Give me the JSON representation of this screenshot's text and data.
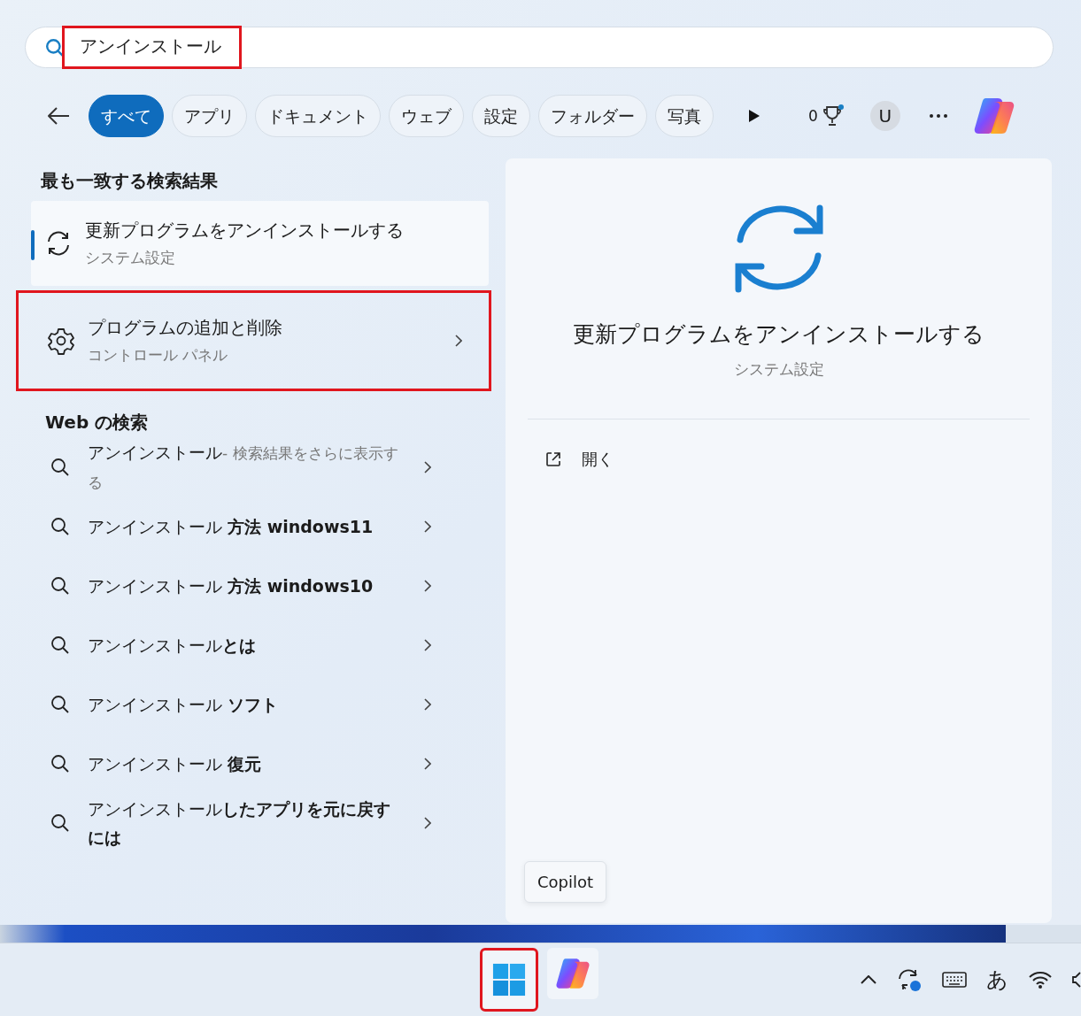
{
  "search": {
    "value": "アンインストール",
    "highlighted": true
  },
  "filters": [
    {
      "label": "すべて",
      "selected": true
    },
    {
      "label": "アプリ",
      "selected": false
    },
    {
      "label": "ドキュメント",
      "selected": false
    },
    {
      "label": "ウェブ",
      "selected": false
    },
    {
      "label": "設定",
      "selected": false
    },
    {
      "label": "フォルダー",
      "selected": false
    },
    {
      "label": "写真",
      "selected": false
    }
  ],
  "toolbar": {
    "points": "0",
    "avatar": "U"
  },
  "best_match": {
    "heading": "最も一致する検索結果",
    "items": [
      {
        "kind": "sync",
        "title": "更新プログラムをアンインストールする",
        "subtitle": "システム設定",
        "selected": true,
        "highlighted": false
      },
      {
        "kind": "gear",
        "title": "プログラムの追加と削除",
        "subtitle": "コントロール パネル",
        "selected": false,
        "highlighted": true
      }
    ]
  },
  "web": {
    "heading": "Web の検索",
    "items": [
      {
        "text": "アンインストール",
        "hint": "- 検索結果をさらに表示する"
      },
      {
        "text": "アンインストール **方法 windows11**"
      },
      {
        "text": "アンインストール **方法 windows10**"
      },
      {
        "text": "アンインストール**とは**"
      },
      {
        "text": "アンインストール **ソフト**"
      },
      {
        "text": "アンインストール **復元**"
      },
      {
        "text": "アンインストール**したアプリを元に戻すには**"
      }
    ]
  },
  "preview": {
    "title": "更新プログラムをアンインストールする",
    "subtitle": "システム設定",
    "actions": [
      {
        "label": "開く"
      }
    ]
  },
  "tooltip": "Copilot",
  "taskbar": {
    "apps": [
      {
        "kind": "start",
        "highlighted": true
      },
      {
        "kind": "copilot",
        "highlighted": false
      }
    ],
    "ime": "あ"
  }
}
